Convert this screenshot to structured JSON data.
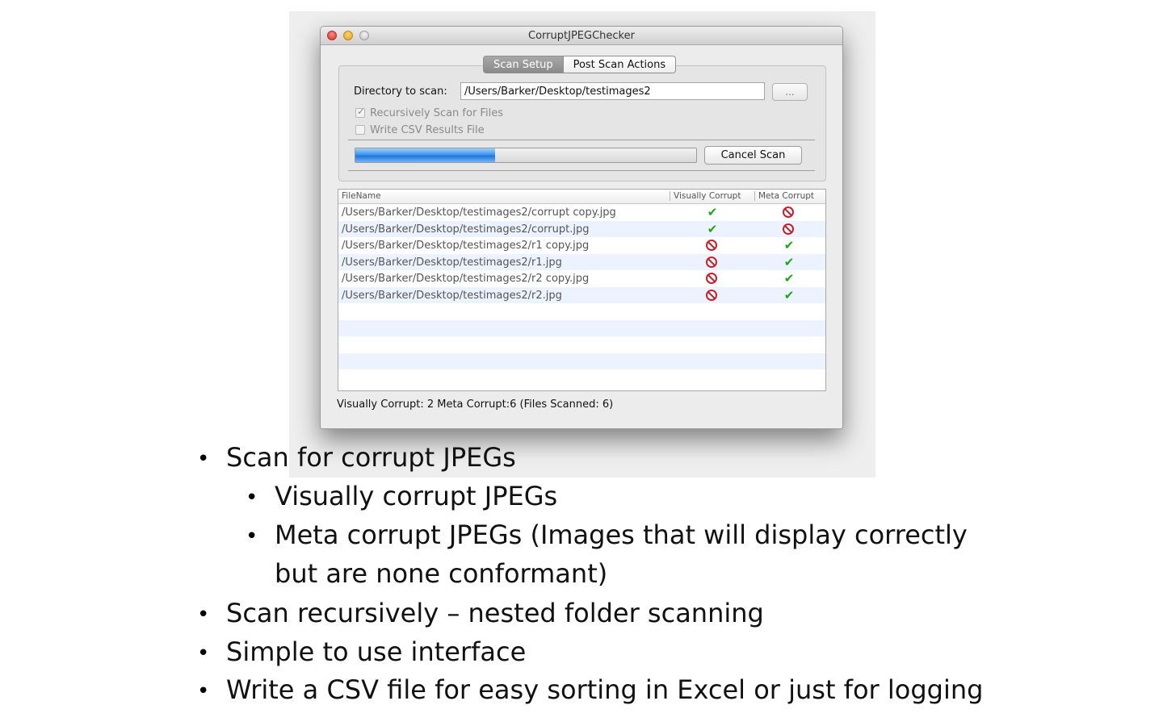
{
  "window": {
    "title": "CorruptJPEGChecker"
  },
  "tabs": [
    {
      "label": "Scan Setup",
      "active": true
    },
    {
      "label": "Post Scan Actions",
      "active": false
    }
  ],
  "scan_setup": {
    "directory_label": "Directory to scan:",
    "directory_value": "/Users/Barker/Desktop/testimages2",
    "browse_label": "...",
    "recursive_label": "Recursively Scan for Files",
    "recursive_checked": true,
    "csv_label": "Write CSV Results File",
    "csv_checked": false,
    "progress": 0.41,
    "cancel_label": "Cancel Scan"
  },
  "table": {
    "columns": [
      "FileName",
      "Visually Corrupt",
      "Meta Corrupt"
    ],
    "rows": [
      {
        "file": "/Users/Barker/Desktop/testimages2/corrupt copy.jpg",
        "visually": "check-icon",
        "meta": "no-entry-icon"
      },
      {
        "file": "/Users/Barker/Desktop/testimages2/corrupt.jpg",
        "visually": "check-icon",
        "meta": "no-entry-icon"
      },
      {
        "file": "/Users/Barker/Desktop/testimages2/r1 copy.jpg",
        "visually": "no-entry-icon",
        "meta": "check-icon"
      },
      {
        "file": "/Users/Barker/Desktop/testimages2/r1.jpg",
        "visually": "no-entry-icon",
        "meta": "check-icon"
      },
      {
        "file": "/Users/Barker/Desktop/testimages2/r2 copy.jpg",
        "visually": "no-entry-icon",
        "meta": "check-icon"
      },
      {
        "file": "/Users/Barker/Desktop/testimages2/r2.jpg",
        "visually": "no-entry-icon",
        "meta": "check-icon"
      }
    ]
  },
  "status": "Visually Corrupt: 2 Meta Corrupt:6 (Files Scanned: 6)",
  "slide": {
    "bullets": [
      "Scan for corrupt JPEGs",
      "Visually corrupt JPEGs",
      "Meta corrupt JPEGs (Images that will display correctly",
      "but are none conformant)",
      "Scan recursively – nested folder scanning",
      "Simple to use interface",
      "Write a CSV file for easy sorting in Excel or just for logging"
    ]
  }
}
